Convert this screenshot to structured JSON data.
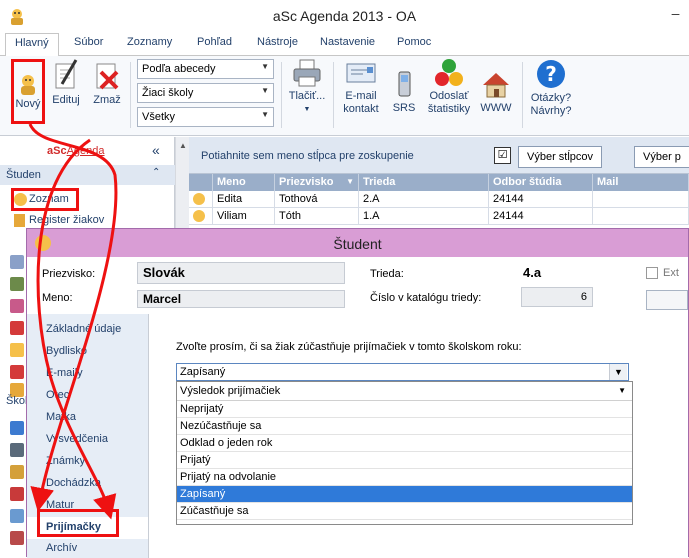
{
  "window": {
    "title": "aSc Agenda 2013 - OA",
    "minimize": "–"
  },
  "menu_tabs": [
    "Hlavný",
    "Súbor",
    "Zoznamy",
    "Pohľad",
    "Nástroje",
    "Nastavenie",
    "Pomoc"
  ],
  "ribbon": {
    "novy": "Nový",
    "edituj": "Edituj",
    "zmaz": "Zmaž",
    "combo_sort": "Podľa abecedy",
    "combo_group": "Žiaci školy",
    "combo_filter": "Všetky",
    "tlacit": "Tlačiť...",
    "email_line1": "E-mail",
    "email_line2": "kontakt",
    "srs": "SRS",
    "odoslat_line1": "Odoslať",
    "odoslat_line2": "štatistiky",
    "www": "WWW",
    "otazky_line1": "Otázky?",
    "otazky_line2": "Návrhy?"
  },
  "leftnav": {
    "logo_prefix": "aSc",
    "logo_suffix": "Agenda",
    "collapse": "«",
    "section_studenti": "Študen",
    "section_skoly": "Škol",
    "items": [
      "Zoznam",
      "Register žiakov"
    ]
  },
  "grid": {
    "group_hint": "Potiahnite sem meno stĺpca pre zoskupenie",
    "btn_columns": "Výber stĺpcov",
    "btn_more": "Výber p",
    "columns": [
      "Meno",
      "Priezvisko",
      "Trieda",
      "Odbor štúdia",
      "Mail"
    ],
    "rows": [
      [
        "Edita",
        "Tothová",
        "2.A",
        "24144",
        ""
      ],
      [
        "Viliam",
        "Tóth",
        "1.A",
        "24144",
        ""
      ]
    ]
  },
  "dialog": {
    "title": "Študent",
    "priezvisko_label": "Priezvisko:",
    "priezvisko_value": "Slovák",
    "meno_label": "Meno:",
    "meno_value": "Marcel",
    "trieda_label": "Trieda:",
    "trieda_value": "4.a",
    "cislo_label": "Číslo v katalógu triedy:",
    "cislo_value": "6",
    "ext_label": "Ext",
    "nav": [
      "Základné údaje",
      "Bydlisko",
      "E-maily",
      "Otec",
      "Matka",
      "Vysvedčenia",
      "Známky",
      "Dochádzka",
      "Matur",
      "Prijímačky",
      "Archív"
    ],
    "question": "Zvoľte prosím, či sa žiak zúčastňuje prijímačiek v tomto školskom roku:",
    "selected": "Zapísaný",
    "dropdown_header": "Výsledok prijímačiek",
    "options": [
      "Neprijatý",
      "Nezúčastňuje sa",
      "Odklad o jeden rok",
      "Prijatý",
      "Prijatý na odvolanie",
      "Zapísaný",
      "Zúčastňuje sa"
    ],
    "selected_index": 5
  },
  "colors": {
    "accent": "#23416b",
    "dialog_title": "#d99dd5",
    "annotation": "#ee1111",
    "selection": "#2f7ad9"
  }
}
